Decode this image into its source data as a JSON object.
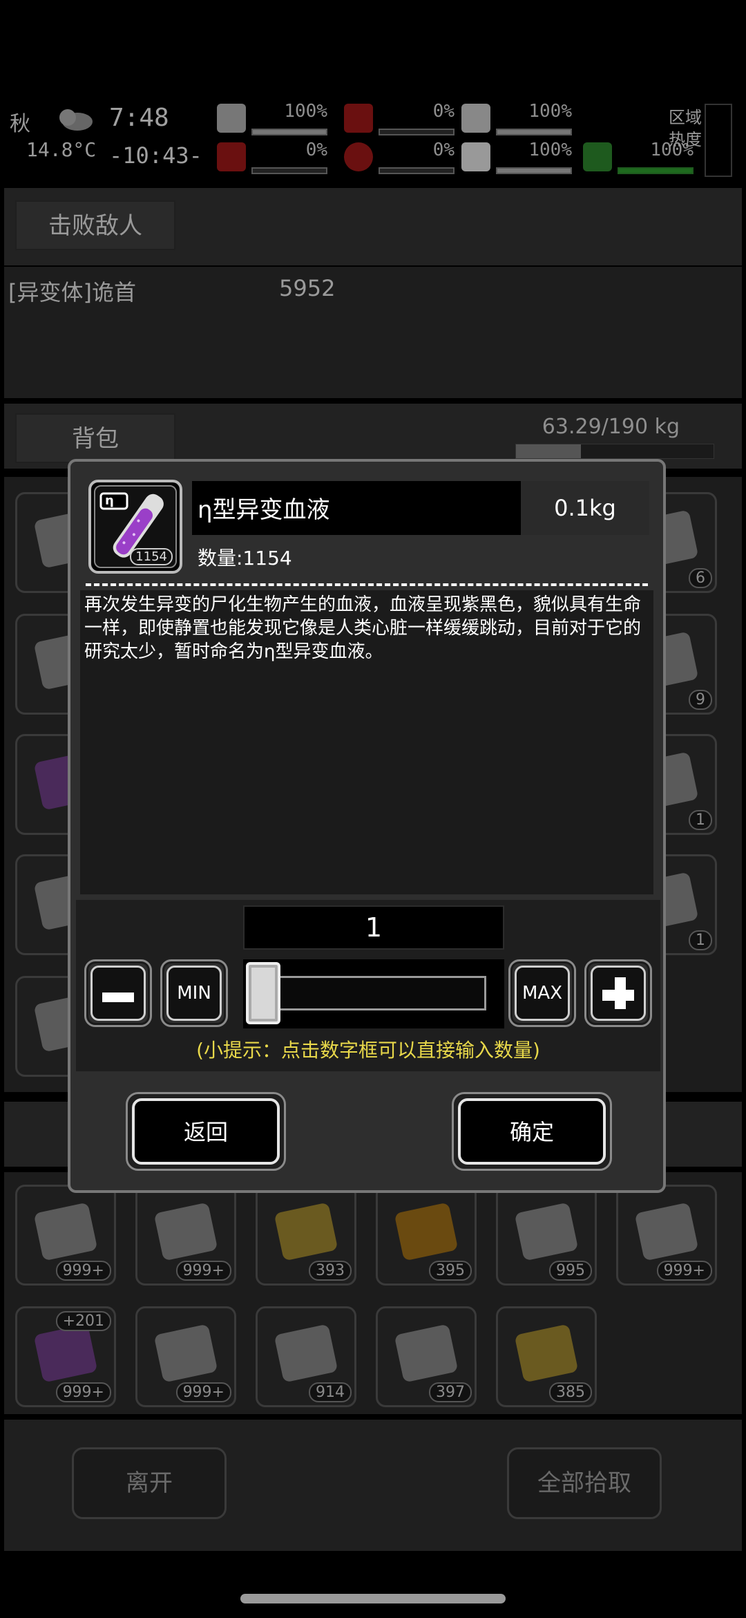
{
  "status": {
    "season": "秋",
    "temperature": "14.8°C",
    "clock_time": "7:48",
    "clock_countdown": "-10:43-",
    "stats": [
      {
        "name": "medkit",
        "value": "100%",
        "fill": 1.0
      },
      {
        "name": "hunger",
        "value": "0%",
        "fill": 0.0
      },
      {
        "name": "water",
        "value": "100%",
        "fill": 1.0
      },
      {
        "name": "bleed",
        "value": "0%",
        "fill": 0.0
      },
      {
        "name": "blood",
        "value": "0%",
        "fill": 0.0
      },
      {
        "name": "health",
        "value": "100%",
        "fill": 1.0
      },
      {
        "name": "stamina",
        "value": "100%",
        "fill": 1.0
      }
    ],
    "region_label": "区域热度"
  },
  "background": {
    "defeat_section": "击败敌人",
    "enemy_name": "[异变体]诡首",
    "enemy_value": "5952",
    "backpack_section": "背包",
    "backpack_weight": "63.29/190 kg",
    "backpack_counts": [
      "6",
      "9",
      "1",
      "1"
    ],
    "ground_counts": [
      "999+",
      "999+",
      "393",
      "395",
      "995",
      "999+",
      "999+",
      "999+",
      "914",
      "397",
      "385"
    ],
    "ground_extra": "+201",
    "leave_button": "离开",
    "pickup_all_button": "全部拾取"
  },
  "dialog": {
    "icon_label": "η",
    "icon_count": "1154",
    "item_name": "η型异变血液",
    "item_weight": "0.1kg",
    "item_quantity": "数量:1154",
    "description": "再次发生异变的尸化生物产生的血液，血液呈现紫黑色，貌似具有生命一样，即使静置也能发现它像是人类心脏一样缓缓跳动，目前对于它的研究太少，暂时命名为η型异变血液。",
    "amount_value": "1",
    "min_label": "MIN",
    "max_label": "MAX",
    "hint": "(小提示：点击数字框可以直接输入数量)",
    "back_button": "返回",
    "confirm_button": "确定"
  }
}
